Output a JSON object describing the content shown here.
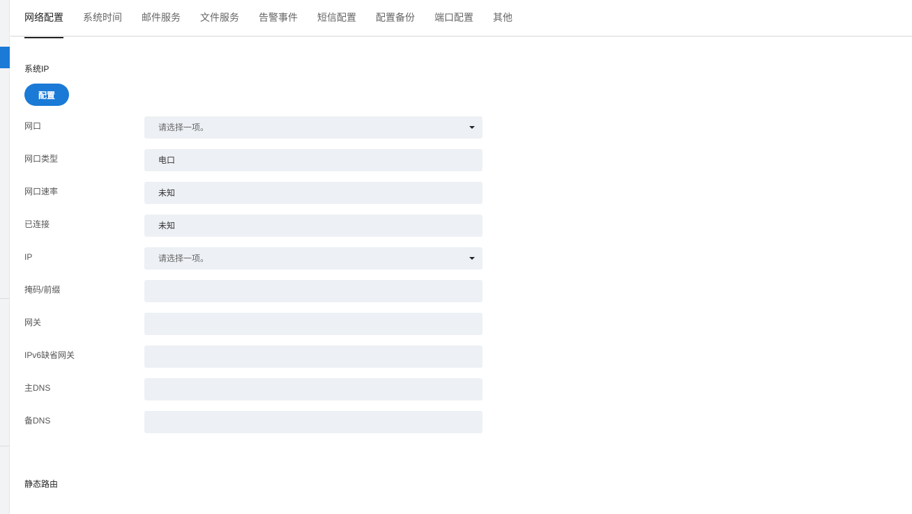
{
  "tabs": [
    {
      "label": "网络配置",
      "active": true
    },
    {
      "label": "系统时间",
      "active": false
    },
    {
      "label": "邮件服务",
      "active": false
    },
    {
      "label": "文件服务",
      "active": false
    },
    {
      "label": "告警事件",
      "active": false
    },
    {
      "label": "短信配置",
      "active": false
    },
    {
      "label": "配置备份",
      "active": false
    },
    {
      "label": "端口配置",
      "active": false
    },
    {
      "label": "其他",
      "active": false
    }
  ],
  "system_ip": {
    "title": "系统IP",
    "config_button": "配置"
  },
  "form": {
    "port": {
      "label": "网口",
      "placeholder": "请选择一项。"
    },
    "port_type": {
      "label": "网口类型",
      "value": "电口"
    },
    "port_speed": {
      "label": "网口速率",
      "value": "未知"
    },
    "connected": {
      "label": "已连接",
      "value": "未知"
    },
    "ip": {
      "label": "IP",
      "placeholder": "请选择一项。"
    },
    "mask": {
      "label": "掩码/前缀",
      "value": ""
    },
    "gateway": {
      "label": "网关",
      "value": ""
    },
    "ipv6_gateway": {
      "label": "IPv6缺省网关",
      "value": ""
    },
    "primary_dns": {
      "label": "主DNS",
      "value": ""
    },
    "secondary_dns": {
      "label": "备DNS",
      "value": ""
    }
  },
  "static_route": {
    "title": "静态路由"
  },
  "colors": {
    "accent": "#1a7ad6",
    "field_bg": "#edf0f4",
    "tab_active": "#222222",
    "tab_inactive": "#666666"
  },
  "icons": {
    "dropdown": "caret-down-icon"
  }
}
